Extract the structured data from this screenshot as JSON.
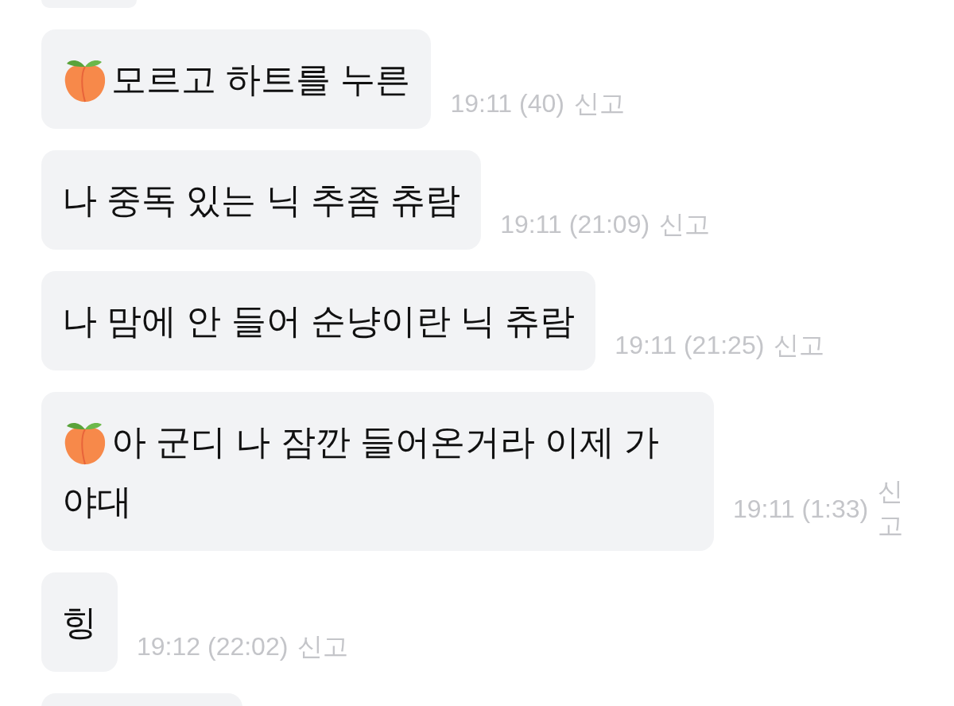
{
  "messages": [
    {
      "text": "모르고 하트를 누른",
      "peach_icon": true,
      "time": "19:11",
      "duration": "(40)",
      "report": "신고"
    },
    {
      "text": "나 중독 있는 닉 추좀 츄람",
      "peach_icon": false,
      "time": "19:11",
      "duration": "(21:09)",
      "report": "신고"
    },
    {
      "text": "나 맘에 안 들어 순냥이란 닉 츄람",
      "peach_icon": false,
      "time": "19:11",
      "duration": "(21:25)",
      "report": "신고"
    },
    {
      "text": "아 군디 나 잠깐 들어온거라 이제 가야대",
      "peach_icon": true,
      "time": "19:11",
      "duration": "(1:33)",
      "report": "신고"
    },
    {
      "text": "힝",
      "peach_icon": false,
      "time": "19:12",
      "duration": "(22:02)",
      "report": "신고"
    }
  ]
}
